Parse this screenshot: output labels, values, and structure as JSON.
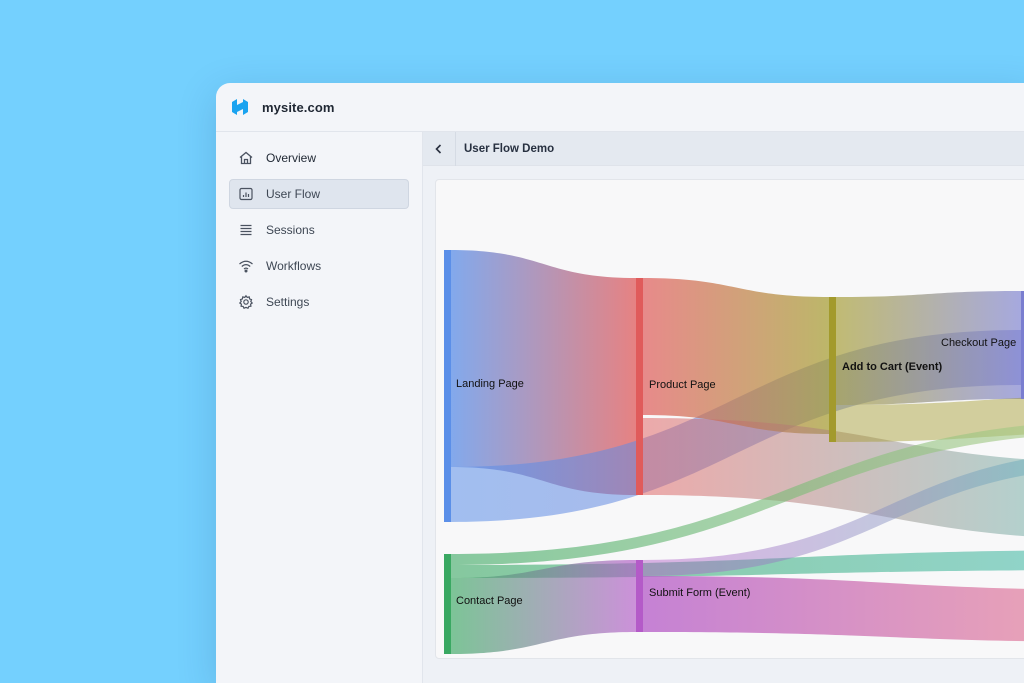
{
  "app": {
    "site_title": "mysite.com"
  },
  "sidebar": {
    "items": [
      {
        "label": "Overview",
        "icon": "home-icon",
        "active": false
      },
      {
        "label": "User Flow",
        "icon": "chart-icon",
        "active": true
      },
      {
        "label": "Sessions",
        "icon": "list-icon",
        "active": false
      },
      {
        "label": "Workflows",
        "icon": "wifi-icon",
        "active": false
      },
      {
        "label": "Settings",
        "icon": "gear-icon",
        "active": false
      }
    ]
  },
  "content": {
    "title": "User Flow Demo"
  },
  "colors": {
    "background": "#74d0fe",
    "accent": "#1aa3f0",
    "landing": "#5b8fe8",
    "product": "#e05b5b",
    "cart": "#a39a2c",
    "checkout": "#7a7ed0",
    "contact": "#3aa862",
    "submit": "#b45ac8",
    "teal": "#4fbfb5"
  },
  "chart_data": {
    "type": "sankey",
    "nodes": [
      {
        "name": "Landing Page"
      },
      {
        "name": "Product Page"
      },
      {
        "name": "Add to Cart (Event)"
      },
      {
        "name": "Checkout Page"
      },
      {
        "name": "Contact Page"
      },
      {
        "name": "Submit Form (Event)"
      }
    ]
  }
}
